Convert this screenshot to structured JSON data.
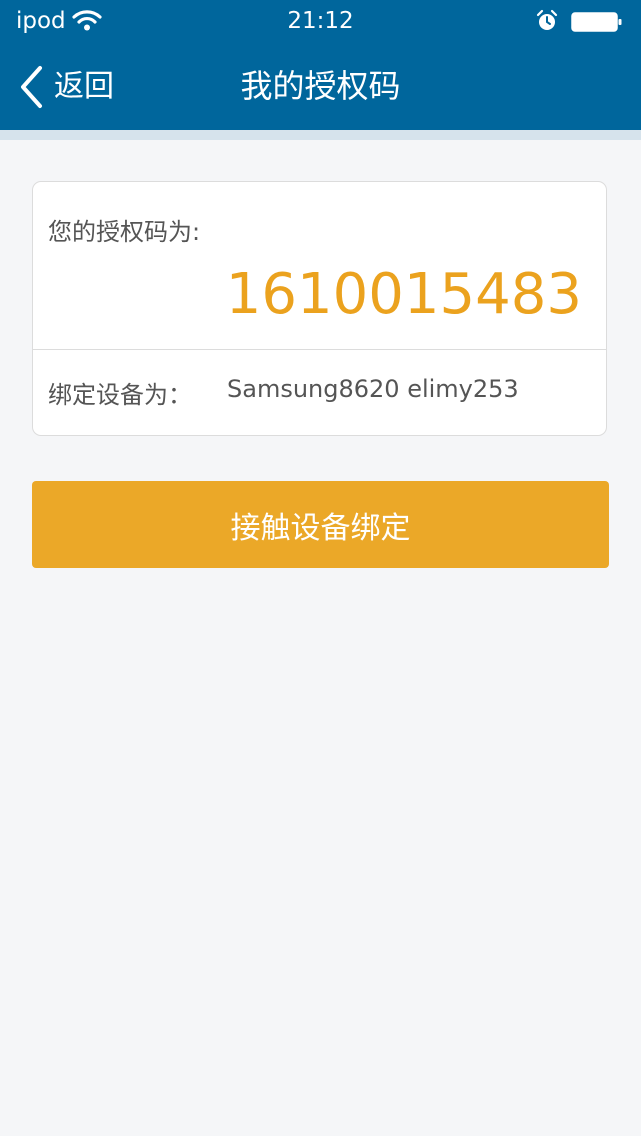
{
  "status_bar": {
    "carrier": "ipod",
    "time": "21:12"
  },
  "nav": {
    "back_label": "返回",
    "title": "我的授权码"
  },
  "card": {
    "code_label": "您的授权码为:",
    "code_value": "1610015483",
    "device_label": "绑定设备为：",
    "device_value": "Samsung8620 elimy253"
  },
  "bind_button": {
    "label": "接触设备绑定"
  },
  "colors": {
    "nav_background": "#00669c",
    "accent": "#eba828",
    "code_text": "#eba21e",
    "page_background": "#f5f6f8"
  },
  "icons": {
    "wifi": "wifi-icon",
    "alarm": "alarm-icon",
    "battery": "battery-icon",
    "back": "chevron-left-icon"
  }
}
